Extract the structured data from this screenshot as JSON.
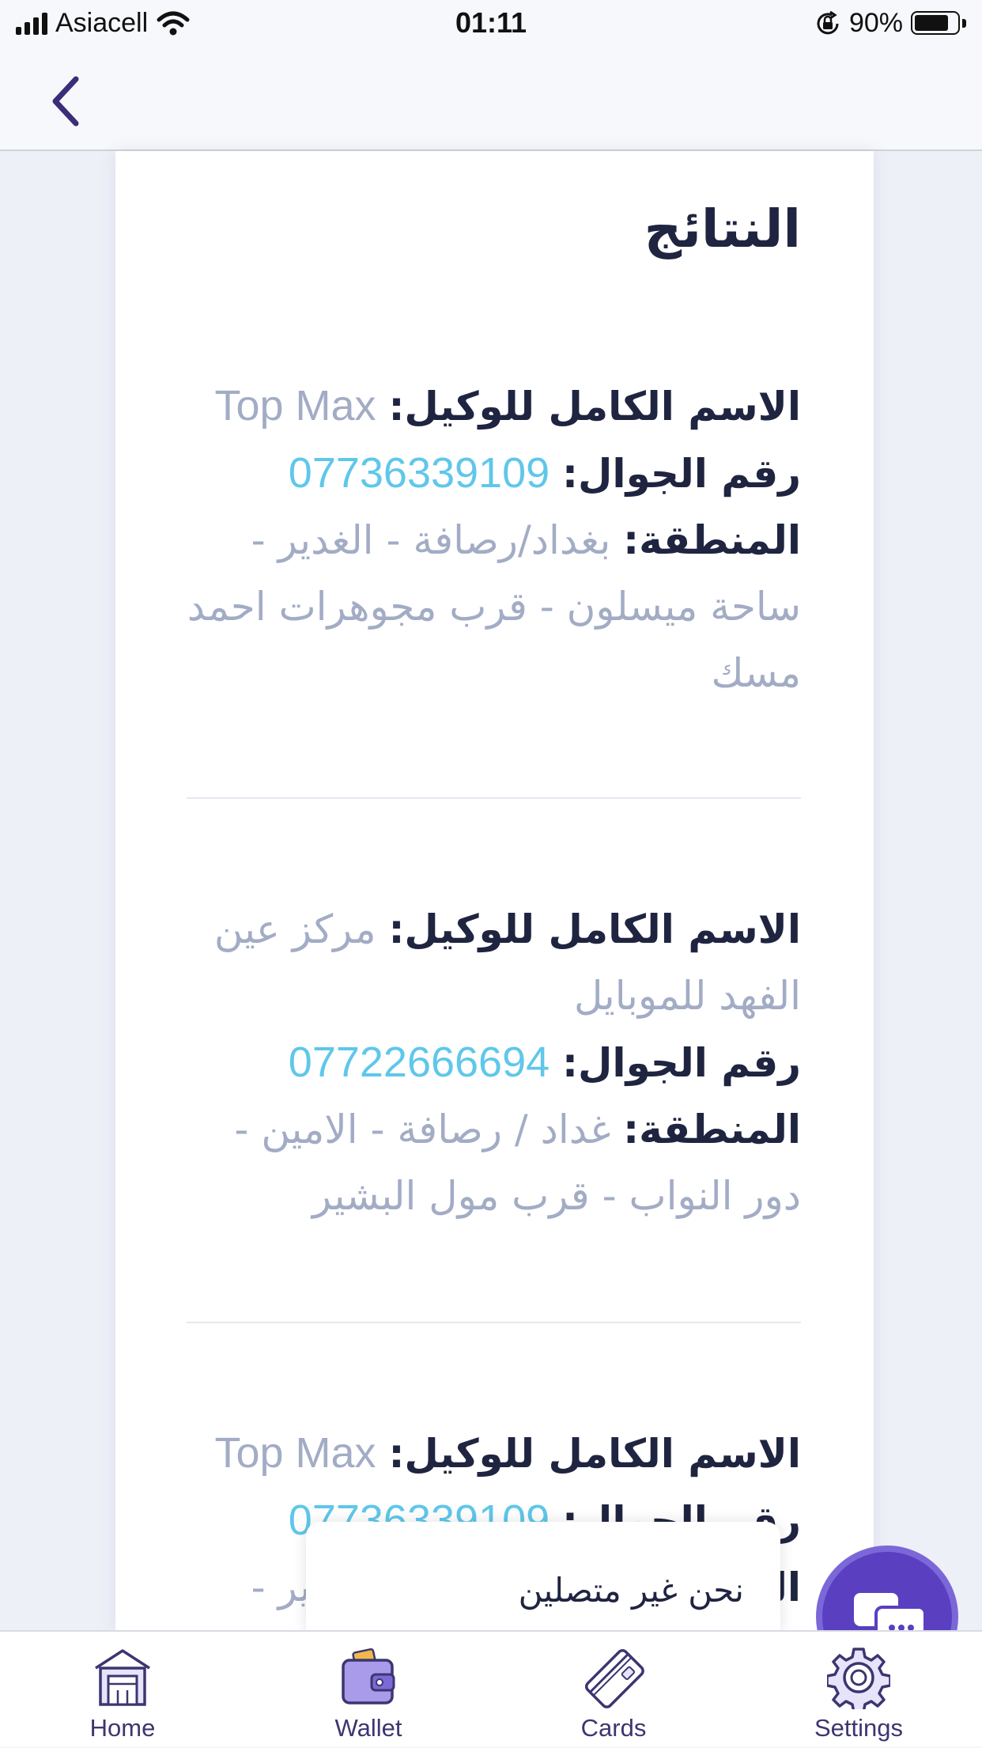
{
  "status_bar": {
    "carrier": "Asiacell",
    "time": "01:11",
    "battery_percent_text": "90%",
    "battery_level": 0.9
  },
  "page": {
    "title": "النتائج"
  },
  "labels": {
    "agent_name": "الاسم الكامل للوكيل:",
    "phone": "رقم الجوال:",
    "area": "المنطقة:"
  },
  "results": [
    {
      "name": "Top Max",
      "phone": "07736339109",
      "area": "بغداد/رصافة - الغدير - ساحة ميسلون - قرب مجوهرات احمد مسك"
    },
    {
      "name": "مركز عين الفهد للموبايل",
      "phone": "07722666694",
      "area": "غداد / رصافة - الامين - دور النواب - قرب مول البشير"
    },
    {
      "name": "Top Max",
      "phone": "07736339109",
      "area": "بغداد/رصافة - الغدير -"
    }
  ],
  "chat": {
    "status_text": "نحن غير متصلين"
  },
  "tabs": [
    {
      "label": "Home",
      "icon": "garage-home-icon"
    },
    {
      "label": "Wallet",
      "icon": "wallet-icon"
    },
    {
      "label": "Cards",
      "icon": "card-icon"
    },
    {
      "label": "Settings",
      "icon": "gear-icon"
    }
  ],
  "colors": {
    "accent": "#5a3fc0",
    "label_text": "#1f2440",
    "value_text": "#a3acc5",
    "phone_text": "#5fc7ea"
  }
}
